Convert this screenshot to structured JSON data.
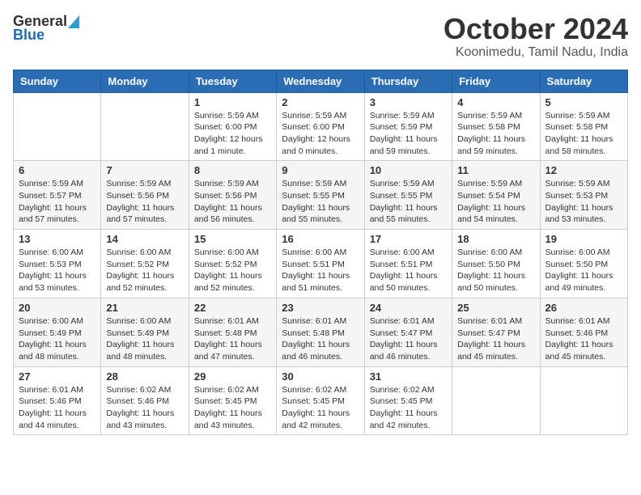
{
  "header": {
    "logo_general": "General",
    "logo_blue": "Blue",
    "month_title": "October 2024",
    "location": "Koonimedu, Tamil Nadu, India"
  },
  "weekdays": [
    "Sunday",
    "Monday",
    "Tuesday",
    "Wednesday",
    "Thursday",
    "Friday",
    "Saturday"
  ],
  "weeks": [
    [
      {
        "day": "",
        "info": ""
      },
      {
        "day": "",
        "info": ""
      },
      {
        "day": "1",
        "info": "Sunrise: 5:59 AM\nSunset: 6:00 PM\nDaylight: 12 hours\nand 1 minute."
      },
      {
        "day": "2",
        "info": "Sunrise: 5:59 AM\nSunset: 6:00 PM\nDaylight: 12 hours\nand 0 minutes."
      },
      {
        "day": "3",
        "info": "Sunrise: 5:59 AM\nSunset: 5:59 PM\nDaylight: 11 hours\nand 59 minutes."
      },
      {
        "day": "4",
        "info": "Sunrise: 5:59 AM\nSunset: 5:58 PM\nDaylight: 11 hours\nand 59 minutes."
      },
      {
        "day": "5",
        "info": "Sunrise: 5:59 AM\nSunset: 5:58 PM\nDaylight: 11 hours\nand 58 minutes."
      }
    ],
    [
      {
        "day": "6",
        "info": "Sunrise: 5:59 AM\nSunset: 5:57 PM\nDaylight: 11 hours\nand 57 minutes."
      },
      {
        "day": "7",
        "info": "Sunrise: 5:59 AM\nSunset: 5:56 PM\nDaylight: 11 hours\nand 57 minutes."
      },
      {
        "day": "8",
        "info": "Sunrise: 5:59 AM\nSunset: 5:56 PM\nDaylight: 11 hours\nand 56 minutes."
      },
      {
        "day": "9",
        "info": "Sunrise: 5:59 AM\nSunset: 5:55 PM\nDaylight: 11 hours\nand 55 minutes."
      },
      {
        "day": "10",
        "info": "Sunrise: 5:59 AM\nSunset: 5:55 PM\nDaylight: 11 hours\nand 55 minutes."
      },
      {
        "day": "11",
        "info": "Sunrise: 5:59 AM\nSunset: 5:54 PM\nDaylight: 11 hours\nand 54 minutes."
      },
      {
        "day": "12",
        "info": "Sunrise: 5:59 AM\nSunset: 5:53 PM\nDaylight: 11 hours\nand 53 minutes."
      }
    ],
    [
      {
        "day": "13",
        "info": "Sunrise: 6:00 AM\nSunset: 5:53 PM\nDaylight: 11 hours\nand 53 minutes."
      },
      {
        "day": "14",
        "info": "Sunrise: 6:00 AM\nSunset: 5:52 PM\nDaylight: 11 hours\nand 52 minutes."
      },
      {
        "day": "15",
        "info": "Sunrise: 6:00 AM\nSunset: 5:52 PM\nDaylight: 11 hours\nand 52 minutes."
      },
      {
        "day": "16",
        "info": "Sunrise: 6:00 AM\nSunset: 5:51 PM\nDaylight: 11 hours\nand 51 minutes."
      },
      {
        "day": "17",
        "info": "Sunrise: 6:00 AM\nSunset: 5:51 PM\nDaylight: 11 hours\nand 50 minutes."
      },
      {
        "day": "18",
        "info": "Sunrise: 6:00 AM\nSunset: 5:50 PM\nDaylight: 11 hours\nand 50 minutes."
      },
      {
        "day": "19",
        "info": "Sunrise: 6:00 AM\nSunset: 5:50 PM\nDaylight: 11 hours\nand 49 minutes."
      }
    ],
    [
      {
        "day": "20",
        "info": "Sunrise: 6:00 AM\nSunset: 5:49 PM\nDaylight: 11 hours\nand 48 minutes."
      },
      {
        "day": "21",
        "info": "Sunrise: 6:00 AM\nSunset: 5:49 PM\nDaylight: 11 hours\nand 48 minutes."
      },
      {
        "day": "22",
        "info": "Sunrise: 6:01 AM\nSunset: 5:48 PM\nDaylight: 11 hours\nand 47 minutes."
      },
      {
        "day": "23",
        "info": "Sunrise: 6:01 AM\nSunset: 5:48 PM\nDaylight: 11 hours\nand 46 minutes."
      },
      {
        "day": "24",
        "info": "Sunrise: 6:01 AM\nSunset: 5:47 PM\nDaylight: 11 hours\nand 46 minutes."
      },
      {
        "day": "25",
        "info": "Sunrise: 6:01 AM\nSunset: 5:47 PM\nDaylight: 11 hours\nand 45 minutes."
      },
      {
        "day": "26",
        "info": "Sunrise: 6:01 AM\nSunset: 5:46 PM\nDaylight: 11 hours\nand 45 minutes."
      }
    ],
    [
      {
        "day": "27",
        "info": "Sunrise: 6:01 AM\nSunset: 5:46 PM\nDaylight: 11 hours\nand 44 minutes."
      },
      {
        "day": "28",
        "info": "Sunrise: 6:02 AM\nSunset: 5:46 PM\nDaylight: 11 hours\nand 43 minutes."
      },
      {
        "day": "29",
        "info": "Sunrise: 6:02 AM\nSunset: 5:45 PM\nDaylight: 11 hours\nand 43 minutes."
      },
      {
        "day": "30",
        "info": "Sunrise: 6:02 AM\nSunset: 5:45 PM\nDaylight: 11 hours\nand 42 minutes."
      },
      {
        "day": "31",
        "info": "Sunrise: 6:02 AM\nSunset: 5:45 PM\nDaylight: 11 hours\nand 42 minutes."
      },
      {
        "day": "",
        "info": ""
      },
      {
        "day": "",
        "info": ""
      }
    ]
  ]
}
